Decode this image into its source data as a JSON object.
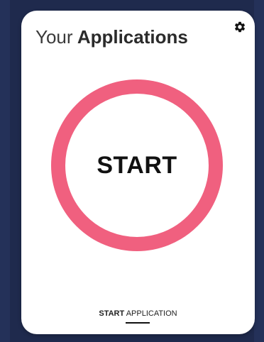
{
  "header": {
    "title_light": "Your",
    "title_bold": "Applications",
    "settings_icon": "gear-icon"
  },
  "main": {
    "start_button_label": "START",
    "ring_color": "#f0607f"
  },
  "footer": {
    "tab_bold": "START",
    "tab_normal": "APPLICATION",
    "active_indicator_color": "#111111"
  },
  "colors": {
    "background": "#1f2a4d",
    "card": "#ffffff",
    "accent": "#f0607f"
  }
}
